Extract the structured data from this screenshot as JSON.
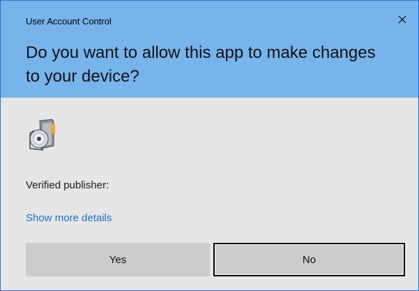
{
  "dialog": {
    "window_title": "User Account Control",
    "question": "Do you want to allow this app to make changes to your device?",
    "verified_publisher_label": "Verified publisher:",
    "show_more_details": "Show more details",
    "yes_label": "Yes",
    "no_label": "No",
    "icons": {
      "close": "close-icon",
      "app": "app-installer-icon"
    }
  },
  "colors": {
    "header_background": "#78b4ec",
    "body_background": "#e6e6e6",
    "link": "#1a6fd0",
    "button": "#cccccc"
  }
}
